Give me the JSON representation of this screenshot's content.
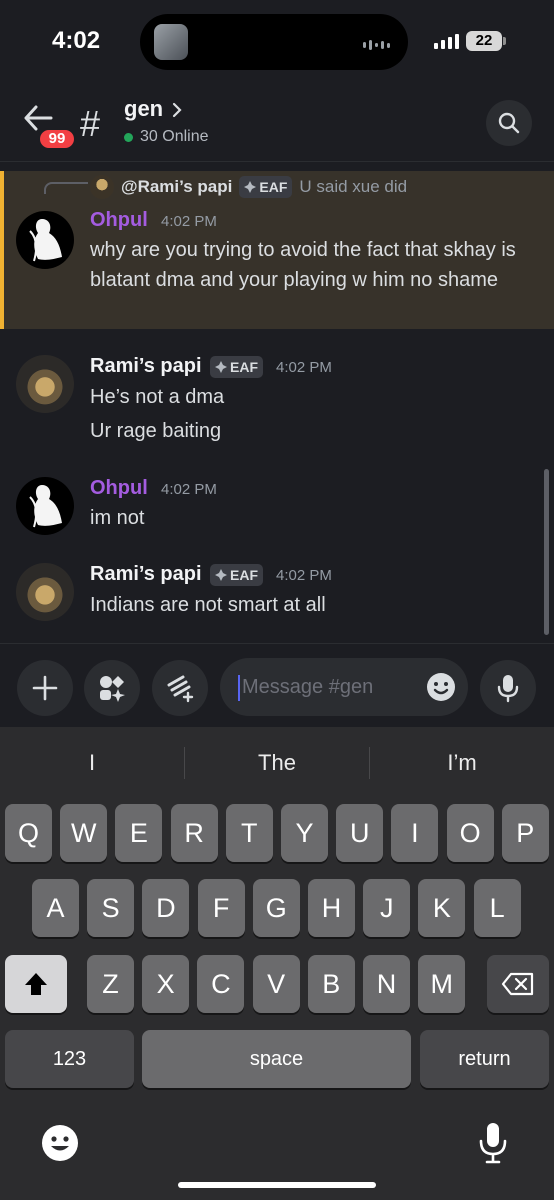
{
  "status_bar": {
    "time": "4:02",
    "battery": "22"
  },
  "header": {
    "badge": "99",
    "hash_symbol": "#",
    "channel": "gen",
    "online": "30 Online"
  },
  "reply": {
    "author": "@Rami’s papi",
    "tag": "EAF",
    "text": "U said xue did"
  },
  "messages": [
    {
      "author": "Ohpul",
      "time": "4:02 PM",
      "lines": [
        "why are you trying to avoid the fact that skhay is blatant dma and your playing w him no shame"
      ]
    },
    {
      "author": "Rami’s papi",
      "tag": "EAF",
      "time": "4:02 PM",
      "lines": [
        "He’s not a dma",
        "Ur rage baiting"
      ]
    },
    {
      "author": "Ohpul",
      "time": "4:02 PM",
      "lines": [
        "im not"
      ]
    },
    {
      "author": "Rami’s papi",
      "tag": "EAF",
      "time": "4:02 PM",
      "lines": [
        "Indians are not smart at all"
      ]
    }
  ],
  "composer": {
    "placeholder": "Message #gen"
  },
  "keyboard": {
    "suggestions": [
      "I",
      "The",
      "I’m"
    ],
    "row1": [
      "Q",
      "W",
      "E",
      "R",
      "T",
      "Y",
      "U",
      "I",
      "O",
      "P"
    ],
    "row2": [
      "A",
      "S",
      "D",
      "F",
      "G",
      "H",
      "J",
      "K",
      "L"
    ],
    "row3": [
      "Z",
      "X",
      "C",
      "V",
      "B",
      "N",
      "M"
    ],
    "numbers_key": "123",
    "space_key": "space",
    "return_key": "return"
  },
  "colors": {
    "background": "#1c1d22",
    "highlight": "#37322a",
    "highlight_border": "#f0b232",
    "ohpul_name": "#a45ce0",
    "online": "#23a55a",
    "badge": "#f23f43"
  }
}
